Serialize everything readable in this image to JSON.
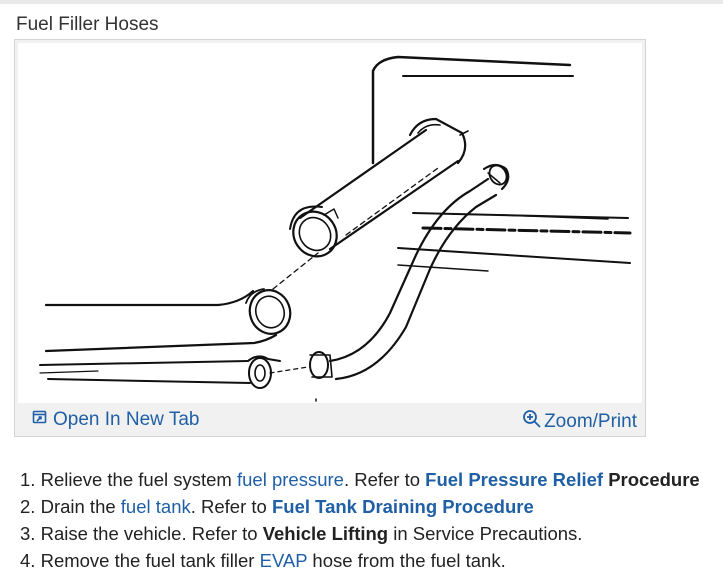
{
  "figure": {
    "title": "Fuel Filler Hoses",
    "image_icon": "fuel-filler-hoses-illustration",
    "open_new_tab_label": "Open In New Tab",
    "open_new_tab_icon": "open-new-tab-icon",
    "zoom_print_label": "Zoom/Print",
    "zoom_icon": "magnifier-icon"
  },
  "steps": [
    {
      "num": "1.",
      "a": "Relieve the fuel system ",
      "link": "fuel pressure",
      "b": ". Refer to ",
      "ref_link": "Fuel Pressure Relief",
      "ref_tail": " Procedure"
    },
    {
      "num": "2.",
      "a": "Drain the ",
      "link": "fuel tank",
      "b": ". Refer to ",
      "ref_link": "Fuel Tank Draining Procedure"
    },
    {
      "num": "3.",
      "a": "Raise the vehicle. Refer to ",
      "bold": "Vehicle Lifting",
      "b": " in Service Precautions."
    },
    {
      "num": "4.",
      "a": "Remove the fuel tank filler ",
      "link": "EVAP",
      "b": " hose from the fuel tank."
    }
  ],
  "colors": {
    "link": "#1f5fa6",
    "text": "#222222",
    "frame_bg": "#f1f1f1"
  }
}
